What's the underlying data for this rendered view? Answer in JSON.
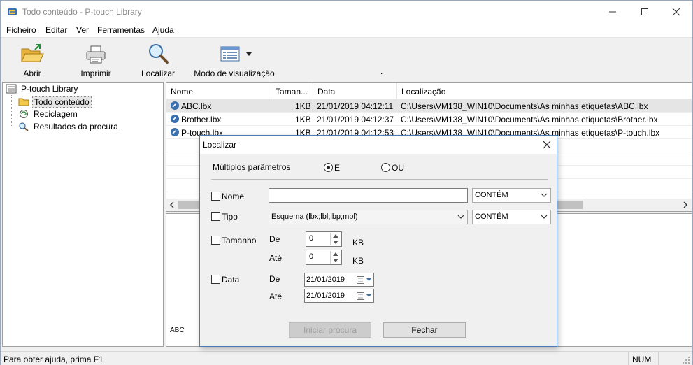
{
  "window": {
    "title": "Todo conteúdo - P-touch Library"
  },
  "menu": [
    "Ficheiro",
    "Editar",
    "Ver",
    "Ferramentas",
    "Ajuda"
  ],
  "toolbar": {
    "open": "Abrir",
    "print": "Imprimir",
    "find": "Localizar",
    "view_mode": "Modo de visualização",
    "dot": "."
  },
  "tree": {
    "root": "P-touch Library",
    "items": [
      "Todo conteúdo",
      "Reciclagem",
      "Resultados da procura"
    ]
  },
  "list": {
    "columns": [
      "Nome",
      "Taman...",
      "Data",
      "Localização"
    ],
    "rows": [
      {
        "name": "ABC.lbx",
        "size": "1KB",
        "date": "21/01/2019 04:12:11",
        "location": "C:\\Users\\VM138_WIN10\\Documents\\As minhas etiquetas\\ABC.lbx"
      },
      {
        "name": "Brother.lbx",
        "size": "1KB",
        "date": "21/01/2019 04:12:37",
        "location": "C:\\Users\\VM138_WIN10\\Documents\\As minhas etiquetas\\Brother.lbx"
      },
      {
        "name": "P-touch.lbx",
        "size": "1KB",
        "date": "21/01/2019 04:12:53",
        "location": "C:\\Users\\VM138_WIN10\\Documents\\As minhas etiquetas\\P-touch.lbx"
      }
    ]
  },
  "preview": {
    "text": "ABC"
  },
  "status": {
    "help": "Para obter ajuda, prima F1",
    "num": "NUM"
  },
  "dialog": {
    "title": "Localizar",
    "multi_label": "Múltiplos parâmetros",
    "and_label": "E",
    "or_label": "OU",
    "name_label": "Nome",
    "name_value": "",
    "name_op": "CONTÉM",
    "type_label": "Tipo",
    "type_value": "Esquema (lbx;lbl;lbp;mbl)",
    "type_op": "CONTÉM",
    "size_label": "Tamanho",
    "from_label": "De",
    "to_label": "Até",
    "size_from": "0",
    "size_to": "0",
    "kb": "KB",
    "date_label": "Data",
    "date_from": "21/01/2019",
    "date_to": "21/01/2019",
    "start_button": "Iniciar procura",
    "close_button": "Fechar"
  }
}
